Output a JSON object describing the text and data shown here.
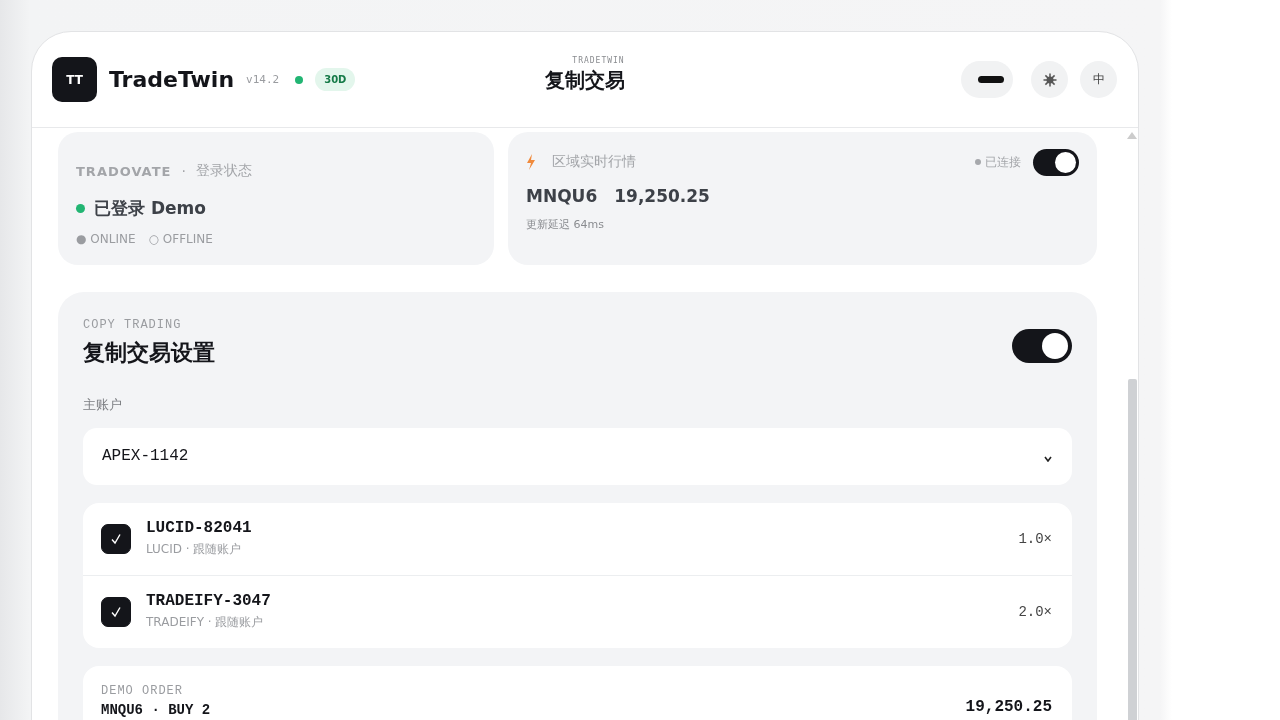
{
  "header": {
    "logo": "TT",
    "app_name": "TradeTwin",
    "version": "v14.2",
    "online": true,
    "badge": "30D",
    "eyebrow": "TRADETWIN",
    "title": "复制交易",
    "buttons": [
      {
        "kind": "font"
      },
      {
        "kind": "theme"
      },
      {
        "kind": "lang",
        "label": "中"
      }
    ]
  },
  "login_card": {
    "brand": "TRADOVATE",
    "separator": "·",
    "label": "登录状态",
    "status": "已登录 Demo",
    "logged_in": true,
    "legend": [
      "● ONLINE",
      "○ OFFLINE"
    ]
  },
  "market_card": {
    "title": "区域实时行情",
    "connection": "已连接",
    "on": true,
    "symbol": "MNQU6",
    "price": "19,250.25",
    "latency": "更新延迟 64ms"
  },
  "copy_trading": {
    "eyebrow": "COPY TRADING",
    "title": "复制交易设置",
    "on": true,
    "master_label": "主账户",
    "master_value": "APEX-1142",
    "followers": [
      {
        "name": "LUCID-82041",
        "sub": "LUCID · 跟随账户",
        "multiplier": "1.0×",
        "checked": true
      },
      {
        "name": "TRADEIFY-3047",
        "sub": "TRADEIFY · 跟随账户",
        "multiplier": "2.0×",
        "checked": true
      }
    ],
    "demo_order": {
      "eyebrow": "DEMO ORDER",
      "line": "MNQU6 · BUY 2",
      "price": "19,250.25"
    }
  }
}
